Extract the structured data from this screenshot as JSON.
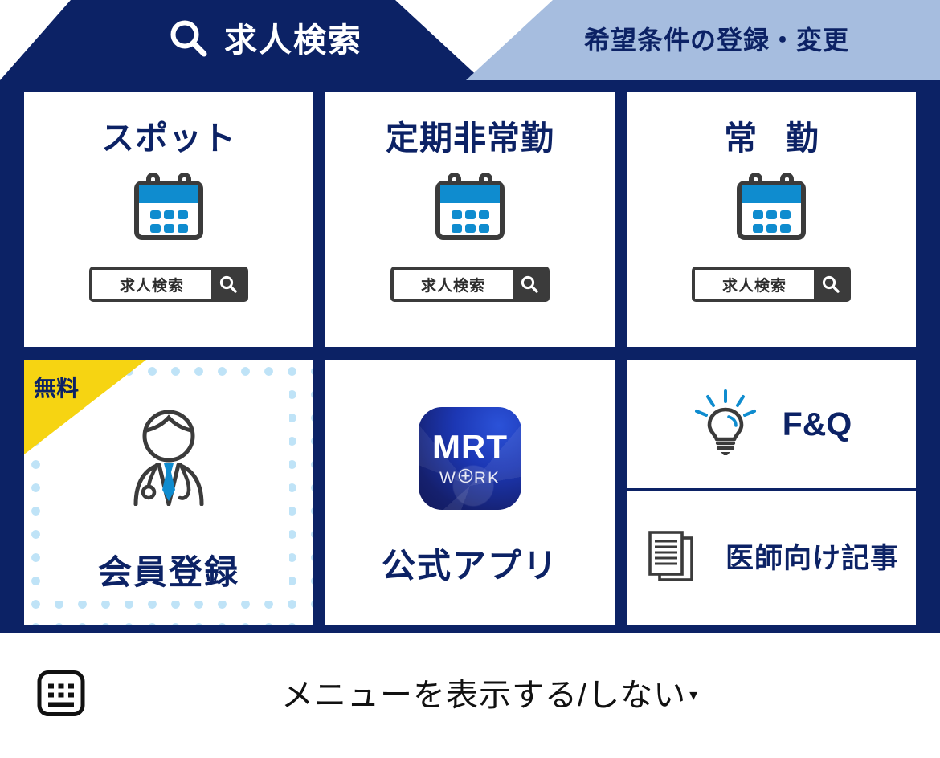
{
  "header": {
    "tabs": [
      {
        "id": "job-search",
        "label": "求人検索",
        "icon": "search-icon",
        "active": true,
        "bg": "#0c2265",
        "fg": "#ffffff"
      },
      {
        "id": "preferences",
        "label": "希望条件の登録・変更",
        "active": false,
        "bg": "#a6bddf",
        "fg": "#0c2265"
      }
    ]
  },
  "colors": {
    "navy": "#0c2265",
    "light_blue_tab": "#a6bddf",
    "accent_blue": "#0f8ccf",
    "dot_blue": "#bfe3f7",
    "badge_yellow": "#f6d412",
    "dark_gray": "#3b3b3b"
  },
  "job_cards": [
    {
      "title": "スポット",
      "icon": "calendar-icon",
      "button_label": "求人検索",
      "button_icon": "magnifier-icon"
    },
    {
      "title": "定期非常勤",
      "icon": "calendar-icon",
      "button_label": "求人検索",
      "button_icon": "magnifier-icon"
    },
    {
      "title": "常 勤",
      "icon": "calendar-icon",
      "button_label": "求人検索",
      "button_icon": "magnifier-icon"
    }
  ],
  "register_card": {
    "badge": "無料",
    "title": "会員登録",
    "icon": "doctor-icon"
  },
  "app_card": {
    "title": "公式アプリ",
    "app_icon": {
      "primary_text": "MRT",
      "secondary_text_left": "W",
      "secondary_text_right": "RK",
      "mark": "medical-cross-icon"
    }
  },
  "info_cells": [
    {
      "label": "F&Q",
      "icon": "lightbulb-icon"
    },
    {
      "label": "医師向け記事",
      "icon": "documents-icon"
    }
  ],
  "bottom_bar": {
    "keyboard_icon": "keyboard-icon",
    "menu_toggle_label": "メニューを表示する/しない",
    "caret": "▾"
  }
}
